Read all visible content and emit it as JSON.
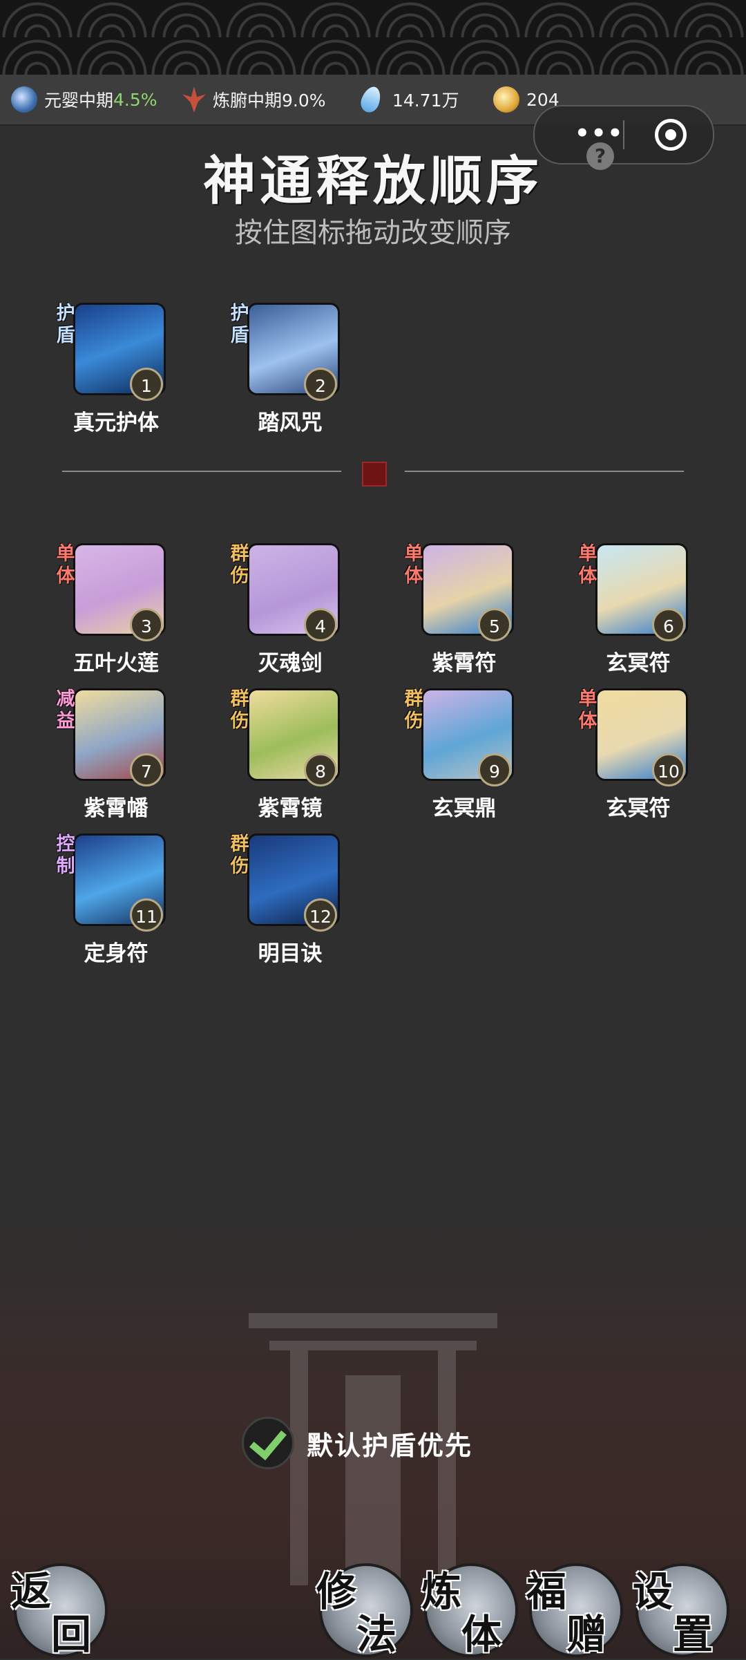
{
  "status": {
    "realm": {
      "label": "元婴中期",
      "pct": "4.5%"
    },
    "body": {
      "label": "炼腑中期9.0%"
    },
    "crystal": {
      "value": "14.71万"
    },
    "coin": {
      "value": "204"
    }
  },
  "icons": {
    "realm": "yin-yang-orb-icon",
    "body": "red-flame-spike-icon",
    "crystal": "blue-crystal-icon",
    "coin": "gold-coin-icon",
    "more": "more-dots-icon",
    "close": "target-close-icon",
    "help": "question-mark-icon",
    "check": "checkmark-icon"
  },
  "help_text": "?",
  "title": "神通释放顺序",
  "subtitle": "按住图标拖动改变顺序",
  "shield_skills": [
    {
      "tag": "护盾",
      "tag_color": "#bfe0ff",
      "num": "1",
      "name": "真元护体",
      "art": "linear-gradient(160deg,#1a3f8a,#3a8ad8 50%,#0e2a5a)"
    },
    {
      "tag": "护盾",
      "tag_color": "#bfe0ff",
      "num": "2",
      "name": "踏风咒",
      "art": "linear-gradient(160deg,#3a5e98,#9ec2ee 55%,#2a4478)"
    }
  ],
  "skills": [
    {
      "tag": "单体",
      "tag_color": "#ff7a6a",
      "num": "3",
      "name": "五叶火莲",
      "art": "linear-gradient(160deg,#d8b6e6,#c79dd8 55%,#e9d2a6)"
    },
    {
      "tag": "群伤",
      "tag_color": "#f2c05a",
      "num": "4",
      "name": "灭魂剑",
      "art": "linear-gradient(160deg,#cdb3e6,#b597d8 60%,#d9c3ee)"
    },
    {
      "tag": "单体",
      "tag_color": "#ff7a6a",
      "num": "5",
      "name": "紫霄符",
      "art": "linear-gradient(160deg,#cdb3e6,#e6d3a8 55%,#2f7bd0)"
    },
    {
      "tag": "单体",
      "tag_color": "#ff7a6a",
      "num": "6",
      "name": "玄冥符",
      "art": "linear-gradient(160deg,#c7e6f2,#e8d9b0 55%,#2f7bd0)"
    },
    {
      "tag": "减益",
      "tag_color": "#ff9ad6",
      "num": "7",
      "name": "紫霄幡",
      "art": "linear-gradient(160deg,#f0dc9e,#8fa6c6 55%,#a44848)"
    },
    {
      "tag": "群伤",
      "tag_color": "#f2c05a",
      "num": "8",
      "name": "紫霄镜",
      "art": "linear-gradient(160deg,#f0dc9e,#9dbd5a 55%,#e9d9a6)"
    },
    {
      "tag": "群伤",
      "tag_color": "#f2c05a",
      "num": "9",
      "name": "玄冥鼎",
      "art": "linear-gradient(160deg,#cdb3e6,#5ea6d6 55%,#b9c2c8)"
    },
    {
      "tag": "单体",
      "tag_color": "#ff7a6a",
      "num": "10",
      "name": "玄冥符",
      "art": "linear-gradient(160deg,#f0dc9e,#e8d9b0 55%,#2f7bd0)"
    },
    {
      "tag": "控制",
      "tag_color": "#e0aaff",
      "num": "11",
      "name": "定身符",
      "art": "linear-gradient(160deg,#1e3f8a,#4ea6e8 55%,#16305e)"
    },
    {
      "tag": "群伤",
      "tag_color": "#f2c05a",
      "num": "12",
      "name": "明目诀",
      "art": "linear-gradient(160deg,#1a3a7a,#2e6cc0 55%,#0d1f44)"
    }
  ],
  "default_shield_label": "默认护盾优先",
  "default_shield_checked": true,
  "nav": {
    "back": [
      "返",
      "回"
    ],
    "cultivate": [
      "修",
      "法"
    ],
    "refine": [
      "炼",
      "体"
    ],
    "gift": [
      "福",
      "赠"
    ],
    "settings": [
      "设",
      "置"
    ]
  }
}
